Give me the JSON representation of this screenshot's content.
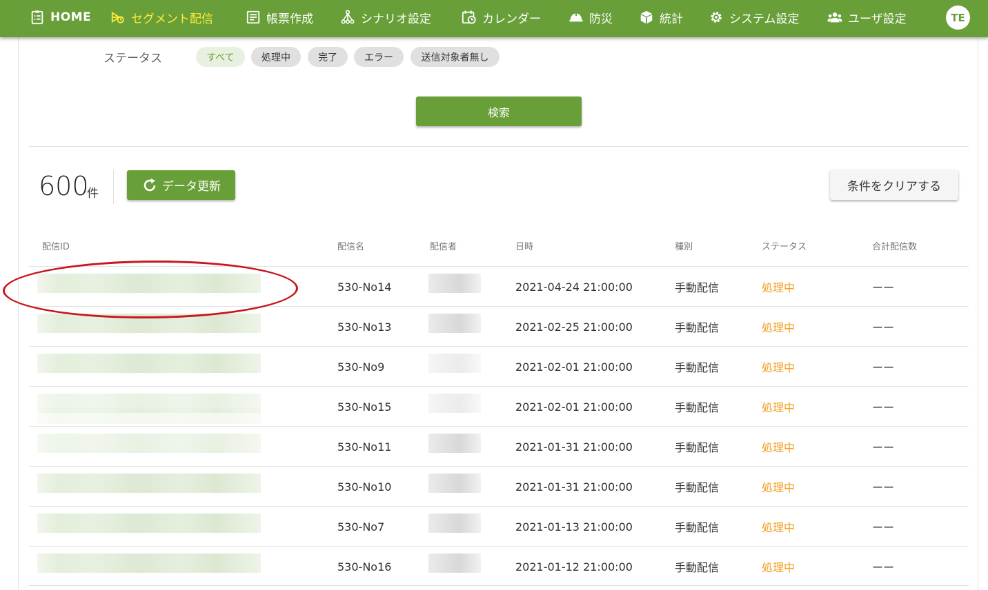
{
  "nav": {
    "items": [
      {
        "label": "HOME",
        "icon": "clipboard-list-icon"
      },
      {
        "label": "セグメント配信",
        "icon": "megaphone-icon"
      },
      {
        "label": "帳票作成",
        "icon": "document-icon"
      },
      {
        "label": "シナリオ設定",
        "icon": "flow-tree-icon"
      },
      {
        "label": "カレンダー",
        "icon": "calendar-clock-icon"
      },
      {
        "label": "防災",
        "icon": "helmet-icon"
      },
      {
        "label": "統計",
        "icon": "cube-icon"
      },
      {
        "label": "システム設定",
        "icon": "gear-icon"
      },
      {
        "label": "ユーザ設定",
        "icon": "users-icon"
      }
    ],
    "avatar": "TE",
    "active_color": "#ffeb3b",
    "bar_color": "#689f38"
  },
  "filter": {
    "status_label": "ステータス",
    "chips": [
      "すべて",
      "処理中",
      "完了",
      "エラー",
      "送信対象者無し"
    ],
    "selected": "すべて",
    "search_button": "検索"
  },
  "results": {
    "count": "600",
    "count_unit": "件",
    "refresh_button": "データ更新",
    "clear_button": "条件をクリアする"
  },
  "table": {
    "headers": [
      "配信ID",
      "配信名",
      "配信者",
      "日時",
      "種別",
      "ステータス",
      "合計配信数"
    ],
    "rows": [
      {
        "name": "530-No14",
        "date": "2021-04-24 21:00:00",
        "type": "手動配信",
        "status": "処理中",
        "total": "ーー"
      },
      {
        "name": "530-No13",
        "date": "2021-02-25 21:00:00",
        "type": "手動配信",
        "status": "処理中",
        "total": "ーー"
      },
      {
        "name": "530-No9",
        "date": "2021-02-01 21:00:00",
        "type": "手動配信",
        "status": "処理中",
        "total": "ーー"
      },
      {
        "name": "530-No15",
        "date": "2021-02-01 21:00:00",
        "type": "手動配信",
        "status": "処理中",
        "total": "ーー"
      },
      {
        "name": "530-No11",
        "date": "2021-01-31 21:00:00",
        "type": "手動配信",
        "status": "処理中",
        "total": "ーー"
      },
      {
        "name": "530-No10",
        "date": "2021-01-31 21:00:00",
        "type": "手動配信",
        "status": "処理中",
        "total": "ーー"
      },
      {
        "name": "530-No7",
        "date": "2021-01-13 21:00:00",
        "type": "手動配信",
        "status": "処理中",
        "total": "ーー"
      },
      {
        "name": "530-No16",
        "date": "2021-01-12 21:00:00",
        "type": "手動配信",
        "status": "処理中",
        "total": "ーー"
      }
    ],
    "status_color": "#f59c1a"
  },
  "annotation_color": "#c8161d"
}
